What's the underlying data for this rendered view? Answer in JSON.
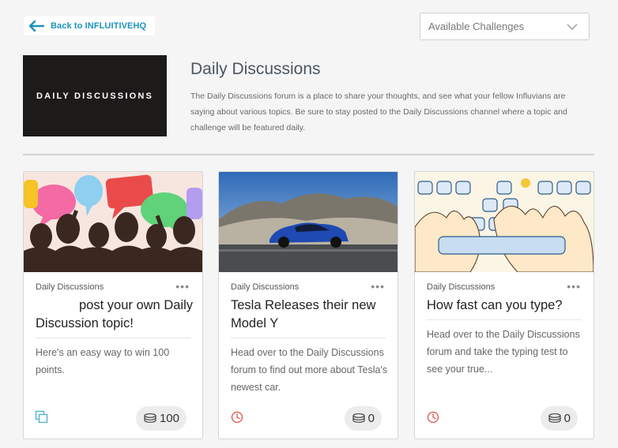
{
  "header": {
    "back_label": "Back to INFLUITIVEHQ",
    "filter_value": "Available Challenges"
  },
  "hero": {
    "image_text": "DAILY DISCUSSIONS",
    "title": "Daily Discussions",
    "description": "The Daily Discussions forum is a place to share your thoughts, and see what your fellow Influvians are saying about various topics. Be sure to stay posted to the Daily Discussions channel where a topic and challenge will be featured daily."
  },
  "cards": [
    {
      "category": "Daily Discussions",
      "menu": "•••",
      "title": "            post your own Daily Discussion topic!",
      "description": "Here's an easy way to win 100 points.",
      "points": "100",
      "type_icon": "stack-icon"
    },
    {
      "category": "Daily Discussions",
      "menu": "•••",
      "title": "Tesla Releases their new Model Y",
      "description": "Head over to the Daily Discussions forum to find out more about Tesla's newest car.",
      "points": "0",
      "type_icon": "clock-icon"
    },
    {
      "category": "Daily Discussions",
      "menu": "•••",
      "title": "How fast can you type?",
      "description": "Head over to the Daily Discussions forum and take the typing test to see your true...",
      "points": "0",
      "type_icon": "clock-icon"
    }
  ],
  "colors": {
    "link": "#1a93b8",
    "clock": "#e0524a",
    "stack": "#4ab0cf"
  }
}
